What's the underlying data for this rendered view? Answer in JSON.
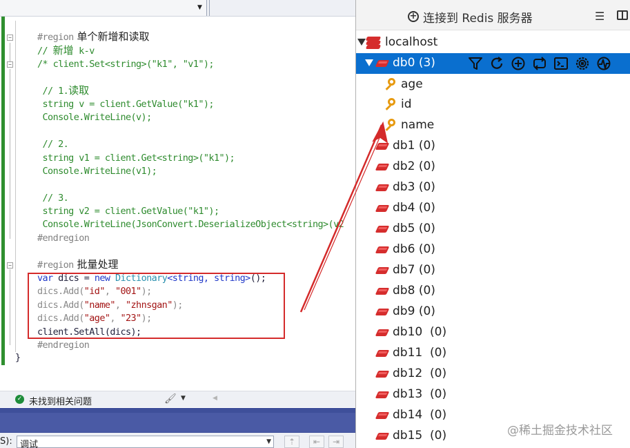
{
  "editor": {
    "lines": {
      "region1_kw": "#region",
      "region1_title": " 单个新增和读取",
      "add_comment_prefix": "// ",
      "add_comment_cjk": "新增",
      "add_comment_suffix": " k-v",
      "set_line": "/* client.Set<string>(\"k1\", \"v1\");",
      "read1_comment_prefix": " // 1.",
      "read1_comment_cjk": "读取",
      "read1_a": " string v = client.GetValue(\"k1\");",
      "read1_b": " Console.WriteLine(v);",
      "read2_comment": " // 2.",
      "read2_a": " string v1 = client.Get<string>(\"k1\");",
      "read2_b": " Console.WriteLine(v1);",
      "read3_comment": " // 3.",
      "read3_a": " string v2 = client.GetValue(\"k1\");",
      "read3_b": " Console.WriteLine(JsonConvert.DeserializeObject<string>(v2",
      "endregion1": "#endregion",
      "region2_kw": "#region",
      "region2_title": " 批量处理",
      "dict_var": "var",
      "dict_mid": " dics = ",
      "dict_new": "new",
      "dict_type": " Dictionary",
      "dict_generic": "<string, string>",
      "dict_end": "();",
      "add1_a": "dics.Add(",
      "add1_b": "\"id\"",
      "add1_c": ", ",
      "add1_d": "\"001\"",
      "add1_e": ");",
      "add2_a": "dics.Add(",
      "add2_b": "\"name\"",
      "add2_c": ", ",
      "add2_d": "\"zhnsgan\"",
      "add2_e": ");",
      "add3_a": "dics.Add(",
      "add3_b": "\"age\"",
      "add3_c": ", ",
      "add3_d": "\"23\"",
      "add3_e": ");",
      "setall": "client.SetAll(dics);",
      "endregion2": "#endregion",
      "closing_brace": "}"
    },
    "fold_symbol": "−",
    "status_text": "未找到相关问题",
    "bottom_label": "S):",
    "bottom_select_value": "调试"
  },
  "panel": {
    "connect_label": "连接到 Redis 服务器",
    "tree": {
      "host": "localhost",
      "db0_label": "db0",
      "db0_count": "(3)",
      "keys": [
        "age",
        "id",
        "name"
      ],
      "databases": [
        {
          "label": "db1",
          "count": "(0)"
        },
        {
          "label": "db2",
          "count": "(0)"
        },
        {
          "label": "db3",
          "count": "(0)"
        },
        {
          "label": "db4",
          "count": "(0)"
        },
        {
          "label": "db5",
          "count": "(0)"
        },
        {
          "label": "db6",
          "count": "(0)"
        },
        {
          "label": "db7",
          "count": "(0)"
        },
        {
          "label": "db8",
          "count": "(0)"
        },
        {
          "label": "db9",
          "count": "(0)"
        },
        {
          "label": "db10",
          "count": "(0)"
        },
        {
          "label": "db11",
          "count": "(0)"
        },
        {
          "label": "db12",
          "count": "(0)"
        },
        {
          "label": "db13",
          "count": "(0)"
        },
        {
          "label": "db14",
          "count": "(0)"
        },
        {
          "label": "db15",
          "count": "(0)"
        }
      ]
    },
    "db0_actions": [
      "filter-icon",
      "reload-icon",
      "add-key-icon",
      "sync-icon",
      "console-icon",
      "settings-icon",
      "stats-icon"
    ]
  },
  "watermark": "@稀土掘金技术社区",
  "colors": {
    "selection": "#0a6fcf",
    "annotation_red": "#d42a2a",
    "redis_red": "#d52d2d",
    "key_orange": "#e79a10"
  }
}
